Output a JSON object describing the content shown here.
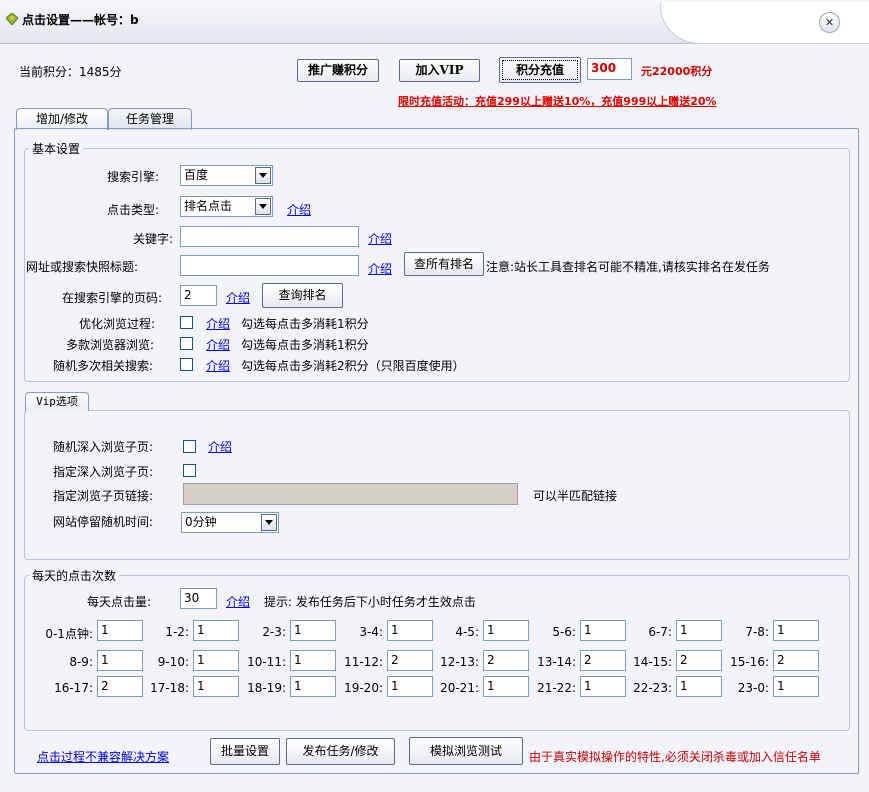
{
  "window": {
    "title": "点击设置——帐号：b"
  },
  "header": {
    "points_text": "当前积分：1485分",
    "promote_label": "推广赚积分",
    "vip_label": "加入VIP",
    "recharge_label": "积分充值",
    "recharge_amount": "300",
    "recharge_rate": "元22000积分",
    "promo_text": "限时充值活动：充值299以上赠送10%，充值999以上赠送20%"
  },
  "tabs": [
    {
      "label": "增加/修改"
    },
    {
      "label": "任务管理"
    }
  ],
  "basic": {
    "title": "基本设置",
    "engine_label": "搜索引擎:",
    "engine_value": "百度",
    "click_type_label": "点击类型:",
    "click_type_value": "排名点击",
    "intro_link": "介绍",
    "keyword_label": "关键字:",
    "keyword_value": "",
    "url_label": "网址或搜索快照标题:",
    "url_value": "",
    "check_all_button": "查所有排名",
    "url_note": "注意:站长工具查排名可能不精准,请核实排名在发任务",
    "page_label": "在搜索引擎的页码:",
    "page_value": "2",
    "query_rank_button": "查询排名",
    "optimize_label": "优化浏览过程:",
    "optimize_note": "勾选每点击多消耗1积分",
    "multi_browser_label": "多款浏览器浏览:",
    "multi_browser_note": "勾选每点击多消耗1积分",
    "random_search_label": "随机多次相关搜索:",
    "random_search_note": "勾选每点击多消耗2积分（只限百度使用）"
  },
  "vip": {
    "title": "Vip选项",
    "deep_browse_label": "随机深入浏览子页:",
    "intro_link": "介绍",
    "specify_deep_label": "指定深入浏览子页:",
    "specify_link_label": "指定浏览子页链接:",
    "specify_link_value": "",
    "half_match_note": "可以半匹配链接",
    "stay_time_label": "网站停留随机时间:",
    "stay_time_value": "0分钟"
  },
  "daily": {
    "title": "每天的点击次数",
    "daily_label": "每天点击量:",
    "daily_value": "30",
    "intro_link": "介绍",
    "tip": "提示: 发布任务后下小时任务才生效点击",
    "slots": [
      {
        "label": "0-1点钟:",
        "value": "1"
      },
      {
        "label": "1-2:",
        "value": "1"
      },
      {
        "label": "2-3:",
        "value": "1"
      },
      {
        "label": "3-4:",
        "value": "1"
      },
      {
        "label": "4-5:",
        "value": "1"
      },
      {
        "label": "5-6:",
        "value": "1"
      },
      {
        "label": "6-7:",
        "value": "1"
      },
      {
        "label": "7-8:",
        "value": "1"
      },
      {
        "label": "8-9:",
        "value": "1"
      },
      {
        "label": "9-10:",
        "value": "1"
      },
      {
        "label": "10-11:",
        "value": "1"
      },
      {
        "label": "11-12:",
        "value": "2"
      },
      {
        "label": "12-13:",
        "value": "2"
      },
      {
        "label": "13-14:",
        "value": "2"
      },
      {
        "label": "14-15:",
        "value": "2"
      },
      {
        "label": "15-16:",
        "value": "2"
      },
      {
        "label": "16-17:",
        "value": "2"
      },
      {
        "label": "17-18:",
        "value": "1"
      },
      {
        "label": "18-19:",
        "value": "1"
      },
      {
        "label": "19-20:",
        "value": "1"
      },
      {
        "label": "20-21:",
        "value": "1"
      },
      {
        "label": "21-22:",
        "value": "1"
      },
      {
        "label": "22-23:",
        "value": "1"
      },
      {
        "label": "23-0:",
        "value": "1"
      }
    ]
  },
  "footer": {
    "compat_link": "点击过程不兼容解决方案",
    "batch_button": "批量设置",
    "publish_button": "发布任务/修改",
    "simulate_button": "模拟浏览测试",
    "warning": "由于真实模拟操作的特性,必须关闭杀毒或加入信任名单"
  }
}
